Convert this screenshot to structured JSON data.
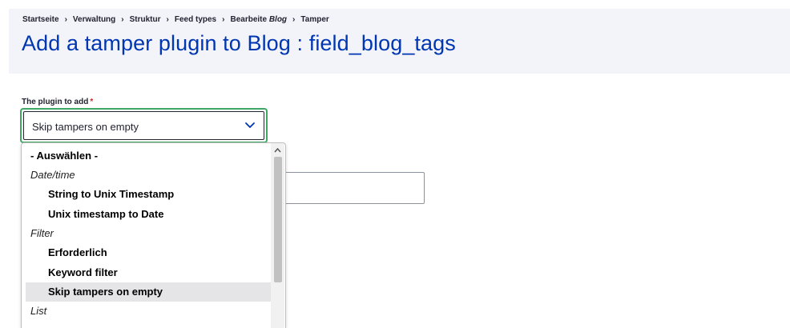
{
  "breadcrumb": {
    "items": [
      "Startseite",
      "Verwaltung",
      "Struktur",
      "Feed types"
    ],
    "edit_prefix": "Bearbeite",
    "edit_name": "Blog",
    "last": "Tamper",
    "separator": "›"
  },
  "page": {
    "title": "Add a tamper plugin to Blog : field_blog_tags"
  },
  "form": {
    "plugin_label": "The plugin to add",
    "required_mark": "*",
    "selected_value": "Skip tampers on empty"
  },
  "dropdown": {
    "default_option": "- Auswählen -",
    "groups": [
      {
        "label": "Date/time",
        "options": [
          "String to Unix Timestamp",
          "Unix timestamp to Date"
        ]
      },
      {
        "label": "Filter",
        "options": [
          "Erforderlich",
          "Keyword filter",
          "Skip tampers on empty"
        ]
      },
      {
        "label": "List",
        "options": []
      }
    ],
    "selected_option": "Skip tampers on empty"
  },
  "colors": {
    "title": "#0036b1",
    "header_bg": "#f3f4f9",
    "focus_ring": "#3fa865",
    "required": "#dc2323",
    "selected_bg": "#e5e5e7"
  },
  "icons": {
    "select_toggle": "chevron-down-icon",
    "scroll_up": "caret-up-icon"
  }
}
